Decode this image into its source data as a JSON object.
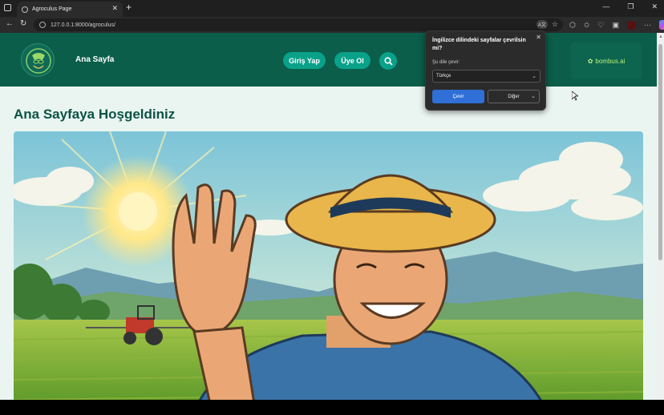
{
  "browser": {
    "tab_title": "Agroculus Page",
    "url": "127.0.0.1:8000/agroculus/"
  },
  "site": {
    "brand": "Ana Sayfa",
    "login_label": "Giriş Yap",
    "signup_label": "Üye Ol",
    "partner_logo": "bombus.ai",
    "heading": "Ana Sayfaya Hoşgeldiniz"
  },
  "translate_popup": {
    "title": "İngilizce dilindeki sayfalar çevrilsin mi?",
    "label": "Şu dile çevir:",
    "language": "Türkçe",
    "translate_label": "Çevir",
    "other_label": "Diğer"
  },
  "colors": {
    "header_bg": "#0b5e4a",
    "button_bg": "#0aa18a",
    "heading": "#0b5345",
    "primary_btn": "#2f6fd6"
  }
}
